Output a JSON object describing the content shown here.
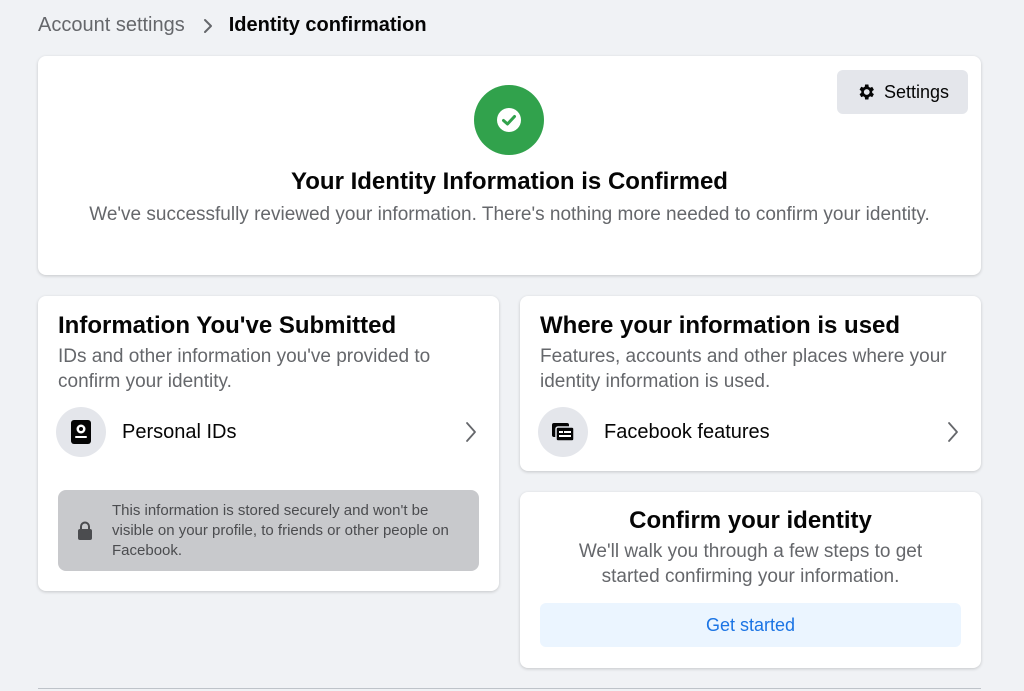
{
  "breadcrumb": {
    "parent": "Account settings",
    "current": "Identity confirmation"
  },
  "status_card": {
    "settings_label": "Settings",
    "title": "Your Identity Information is Confirmed",
    "description": "We've successfully reviewed your information. There's nothing more needed to confirm your identity."
  },
  "submitted_card": {
    "title": "Information You've Submitted",
    "description": "IDs and other information you've provided to confirm your identity.",
    "item_label": "Personal IDs",
    "notice": "This information is stored securely and won't be visible on your profile, to friends or other people on Facebook."
  },
  "used_card": {
    "title": "Where your information is used",
    "description": "Features, accounts and other places where your identity information is used.",
    "item_label": "Facebook features"
  },
  "confirm_card": {
    "title": "Confirm your identity",
    "description": "We'll walk you through a few steps to get started confirming your information.",
    "button_label": "Get started"
  },
  "icons": [
    "chevron-right-icon",
    "gear-icon",
    "check-circle-icon",
    "id-card-icon",
    "features-icon",
    "lock-icon"
  ],
  "colors": {
    "background": "#f0f2f5",
    "success_green": "#31a24c",
    "accent_blue": "#1b74e4",
    "button_light_blue": "#ebf5ff",
    "notice_gray": "#c8c9cc"
  }
}
